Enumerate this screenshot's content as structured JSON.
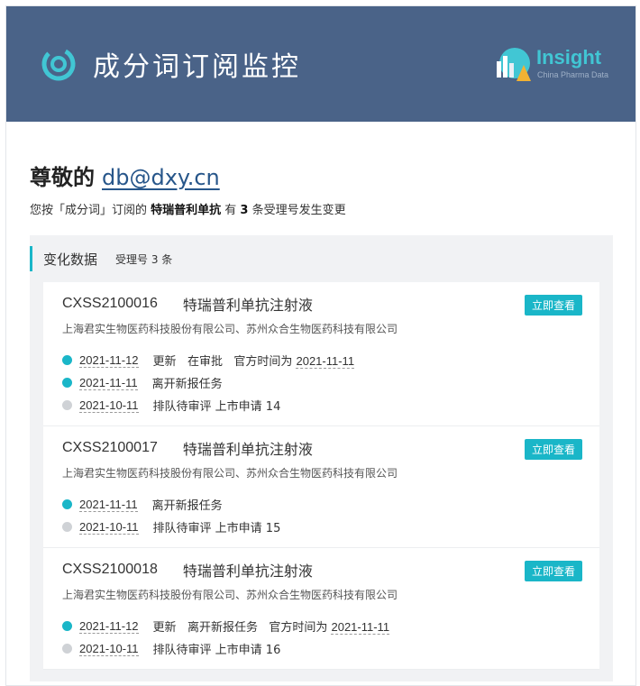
{
  "header": {
    "title": "成分词订阅监控",
    "brand_name": "Insight",
    "brand_sub": "China Pharma Data",
    "brand_color": "#41c6d4",
    "bg_color": "#4a6388"
  },
  "greeting": {
    "prefix": "尊敬的",
    "email": "db@dxy.cn"
  },
  "summary": {
    "part1": "您按「成分词」订阅的 ",
    "drug": "特瑞普利单抗",
    "part2": " 有 ",
    "count": "3",
    "part3": " 条受理号发生变更"
  },
  "panel": {
    "title": "变化数据",
    "count_label": "受理号 3 条",
    "accent": "#1ab6c8"
  },
  "cards": [
    {
      "code": "CXSS2100016",
      "drug": "特瑞普利单抗注射液",
      "button": "立即查看",
      "company": "上海君实生物医药科技股份有限公司、苏州众合生物医药科技有限公司",
      "events": [
        {
          "date": "2021-11-12",
          "status": "active",
          "text": "更新   在审批   官方时间为 ",
          "official_date": "2021-11-11"
        },
        {
          "date": "2021-11-11",
          "status": "active",
          "text": "离开新报任务",
          "official_date": ""
        },
        {
          "date": "2021-10-11",
          "status": "inactive",
          "text": "排队待审评 上市申请 14",
          "official_date": ""
        }
      ]
    },
    {
      "code": "CXSS2100017",
      "drug": "特瑞普利单抗注射液",
      "button": "立即查看",
      "company": "上海君实生物医药科技股份有限公司、苏州众合生物医药科技有限公司",
      "events": [
        {
          "date": "2021-11-11",
          "status": "active",
          "text": "离开新报任务",
          "official_date": ""
        },
        {
          "date": "2021-10-11",
          "status": "inactive",
          "text": "排队待审评 上市申请 15",
          "official_date": ""
        }
      ]
    },
    {
      "code": "CXSS2100018",
      "drug": "特瑞普利单抗注射液",
      "button": "立即查看",
      "company": "上海君实生物医药科技股份有限公司、苏州众合生物医药科技有限公司",
      "events": [
        {
          "date": "2021-11-12",
          "status": "active",
          "text": "更新   离开新报任务   官方时间为 ",
          "official_date": "2021-11-11"
        },
        {
          "date": "2021-10-11",
          "status": "inactive",
          "text": "排队待审评 上市申请 16",
          "official_date": ""
        }
      ]
    }
  ]
}
